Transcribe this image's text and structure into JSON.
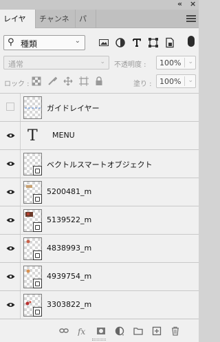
{
  "tabs": [
    {
      "label": "レイヤー",
      "active": true
    },
    {
      "label": "チャンネル",
      "active": false
    },
    {
      "label": "パス",
      "active": false
    }
  ],
  "filter": {
    "kind_label": "種類"
  },
  "blend": {
    "mode": "通常",
    "opacity_label": "不透明度 :",
    "opacity_value": "100%"
  },
  "lock": {
    "label": "ロック :",
    "fill_label": "塗り :",
    "fill_value": "100%"
  },
  "layers": [
    {
      "name": "ガイドレイヤー",
      "type": "guide",
      "visible": false
    },
    {
      "name": "MENU",
      "type": "text",
      "visible": true
    },
    {
      "name": "ベクトルスマートオブジェクト",
      "type": "smart",
      "visible": true
    },
    {
      "name": "5200481_m",
      "type": "smart",
      "visible": true
    },
    {
      "name": "5139522_m",
      "type": "smart",
      "visible": true
    },
    {
      "name": "4838993_m",
      "type": "smart",
      "visible": true
    },
    {
      "name": "4939754_m",
      "type": "smart",
      "visible": true
    },
    {
      "name": "3303822_m",
      "type": "smart",
      "visible": true
    }
  ],
  "colors": {
    "panel_bg": "#f0f0f0",
    "chrome": "#c0c0c0",
    "text": "#111111"
  }
}
